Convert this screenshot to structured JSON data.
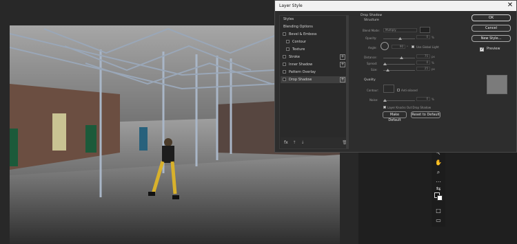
{
  "dialog": {
    "title": "Layer Style",
    "close_glyph": "✕",
    "styles_panel": {
      "items": [
        {
          "label": "Styles",
          "indent": false,
          "checkbox": false,
          "plus": false,
          "active": false
        },
        {
          "label": "Blending Options",
          "indent": false,
          "checkbox": false,
          "plus": false,
          "active": false
        },
        {
          "label": "Bevel & Emboss",
          "indent": false,
          "checkbox": true,
          "plus": false,
          "active": false
        },
        {
          "label": "Contour",
          "indent": true,
          "checkbox": true,
          "plus": false,
          "active": false
        },
        {
          "label": "Texture",
          "indent": true,
          "checkbox": true,
          "plus": false,
          "active": false
        },
        {
          "label": "Stroke",
          "indent": false,
          "checkbox": true,
          "plus": true,
          "active": false
        },
        {
          "label": "Inner Shadow",
          "indent": false,
          "checkbox": true,
          "plus": true,
          "active": false
        },
        {
          "label": "Pattern Overlay",
          "indent": false,
          "checkbox": true,
          "plus": false,
          "active": false
        },
        {
          "label": "Drop Shadow",
          "indent": false,
          "checkbox": true,
          "plus": true,
          "active": true
        }
      ],
      "footer": {
        "fx_label": "fx",
        "up_glyph": "↑",
        "down_glyph": "↓",
        "trash_glyph": "🗑"
      }
    },
    "settings": {
      "title": "Drop Shadow",
      "structure_label": "Structure",
      "blend_mode_label": "Blend Mode:",
      "blend_mode_value": "Multiply",
      "opacity_label": "Opacity:",
      "opacity_value": "0",
      "angle_label": "Angle:",
      "angle_value": "90",
      "use_global_light_label": "Use Global Light",
      "distance_label": "Distance:",
      "distance_value": "75",
      "spread_label": "Spread:",
      "spread_value": "0",
      "size_label": "Size:",
      "size_value": "25",
      "quality_label": "Quality",
      "contour_label": "Contour:",
      "anti_aliased_label": "Anti-aliased",
      "noise_label": "Noise:",
      "noise_value": "0",
      "layer_knocks_out_label": "Layer Knocks Out Drop Shadow",
      "make_default_label": "Make Default",
      "reset_default_label": "Reset to Default",
      "percent_unit": "%",
      "px_unit": "px",
      "degree_unit": "°"
    },
    "buttons": {
      "ok_label": "OK",
      "cancel_label": "Cancel",
      "new_style_label": "New Style...",
      "preview_label": "Preview"
    }
  },
  "tools": [
    {
      "name": "select-icon",
      "glyph": "↖"
    },
    {
      "name": "hand-icon",
      "glyph": "✋"
    },
    {
      "name": "zoom-icon",
      "glyph": "⌕"
    },
    {
      "name": "more-icon",
      "glyph": "⋯"
    },
    {
      "name": "color-swap-icon",
      "glyph": "⇆"
    },
    {
      "name": "quick-mask-icon",
      "glyph": "□"
    },
    {
      "name": "screen-mode-icon",
      "glyph": "▭"
    }
  ],
  "colors": {
    "workspace": "#1f1f1f",
    "dialog_bg": "#2d2d2d",
    "titlebar": "#f2f2f2",
    "accent": "#cfcfcf"
  }
}
